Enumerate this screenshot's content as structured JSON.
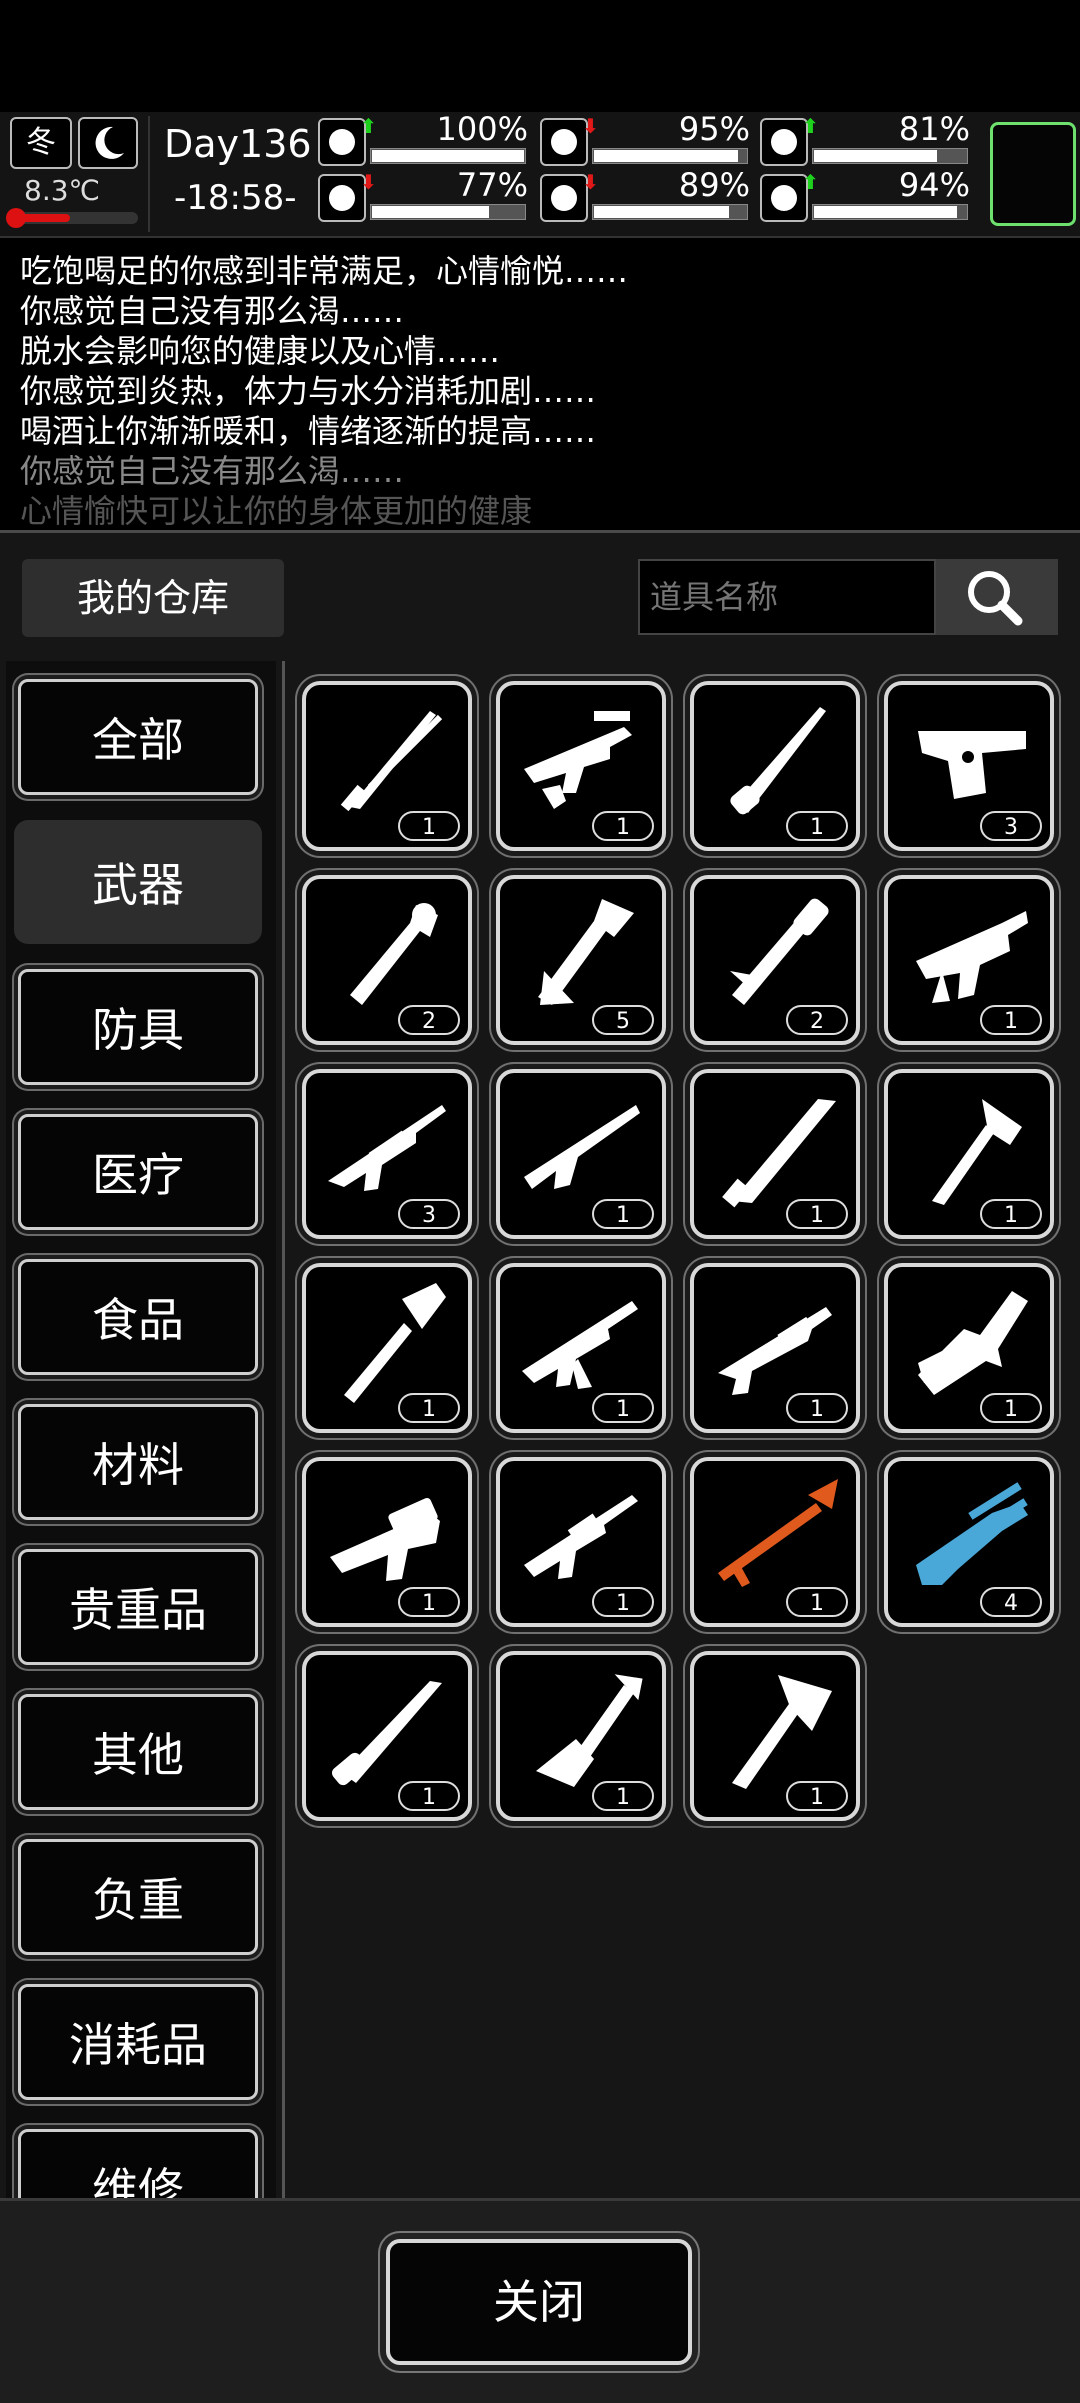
{
  "hud": {
    "season": "冬",
    "temperature": "8.3℃",
    "day": "Day136",
    "time": "-18:58-",
    "stats": [
      {
        "name": "health-icon",
        "value": "100%",
        "trend": "up",
        "level": 1.0
      },
      {
        "name": "stomach-icon",
        "value": "95%",
        "trend": "down",
        "level": 0.95
      },
      {
        "name": "mood-icon",
        "value": "81%",
        "trend": "up",
        "level": 0.81
      },
      {
        "name": "stamina-icon",
        "value": "77%",
        "trend": "down",
        "level": 0.77
      },
      {
        "name": "water-icon",
        "value": "89%",
        "trend": "down",
        "level": 0.89
      },
      {
        "name": "heart-icon",
        "value": "94%",
        "trend": "up",
        "level": 0.94
      }
    ],
    "thermometer_level": 0.4
  },
  "log": [
    "吃饱喝足的你感到非常满足，心情愉悦……",
    "你感觉自己没有那么渴……",
    "脱水会影响您的健康以及心情……",
    "你感觉到炎热，体力与水分消耗加剧……",
    "喝酒让你渐渐暖和，情绪逐渐的提高……",
    "你感觉自己没有那么渴……",
    "心情愉快可以让你的身体更加的健康"
  ],
  "warehouse": {
    "tab_label": "我的仓库",
    "search_placeholder": "道具名称",
    "categories": [
      "全部",
      "武器",
      "防具",
      "医疗",
      "食品",
      "材料",
      "贵重品",
      "其他",
      "负重",
      "消耗品",
      "维修"
    ],
    "active_category": "武器",
    "items": [
      {
        "icon": "katana-icon",
        "qty": "1"
      },
      {
        "icon": "assault-rifle-icon",
        "qty": "1"
      },
      {
        "icon": "bayonet-icon",
        "qty": "1"
      },
      {
        "icon": "desert-eagle-icon",
        "qty": "3"
      },
      {
        "icon": "grenade-launcher-icon",
        "qty": "2"
      },
      {
        "icon": "fire-axe-icon",
        "qty": "5"
      },
      {
        "icon": "baton-icon",
        "qty": "2"
      },
      {
        "icon": "nail-gun-icon",
        "qty": "1"
      },
      {
        "icon": "sniper-rifle-icon",
        "qty": "3"
      },
      {
        "icon": "hunting-rifle-icon",
        "qty": "1"
      },
      {
        "icon": "machete-icon",
        "qty": "1"
      },
      {
        "icon": "hatchet-icon",
        "qty": "1"
      },
      {
        "icon": "shovel-icon",
        "qty": "1"
      },
      {
        "icon": "ak-rifle-icon",
        "qty": "1"
      },
      {
        "icon": "shotgun-icon",
        "qty": "1"
      },
      {
        "icon": "chainsaw-icon",
        "qty": "1"
      },
      {
        "icon": "grenade-rifle-icon",
        "qty": "1"
      },
      {
        "icon": "m16-rifle-icon",
        "qty": "1"
      },
      {
        "icon": "rpg-icon",
        "qty": "1"
      },
      {
        "icon": "minigun-icon",
        "qty": "4"
      },
      {
        "icon": "combat-knife-icon",
        "qty": "1"
      },
      {
        "icon": "spade-icon",
        "qty": "1"
      },
      {
        "icon": "axe-icon",
        "qty": "1"
      }
    ],
    "item_colors": {
      "rpg-icon": "#e05a1e",
      "minigun-icon": "#4aa8d8"
    }
  },
  "close_label": "关闭"
}
